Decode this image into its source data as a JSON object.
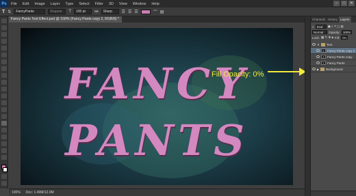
{
  "app": {
    "logo": "Ps"
  },
  "menu": [
    "File",
    "Edit",
    "Image",
    "Layer",
    "Type",
    "Select",
    "Filter",
    "3D",
    "View",
    "Window",
    "Help"
  ],
  "window_controls": [
    "–",
    "□",
    "✕"
  ],
  "options": {
    "font_family": "FancyPants",
    "font_style": "Regular",
    "font_size": "100 pt",
    "anti_alias": "Sharp",
    "text_color": "#c97db0"
  },
  "document": {
    "tab_title": "Fancy Pants Text Effect.psd @ 100% (Fancy Pants copy 2, RGB/8) *",
    "line1": "FANCY",
    "line2": "PANTS",
    "callout": "Fill Opacity: 0%",
    "callout_color": "#f4ea3c"
  },
  "status": {
    "zoom": "100%",
    "doc_size": "Doc: 1.49M/12.0M"
  },
  "panel": {
    "tabs": [
      "Channels",
      "History",
      "Layers"
    ],
    "active_tab": "Layers",
    "kind": "Kind",
    "blend_mode": "Normal",
    "opacity_label": "Opacity:",
    "opacity_value": "100%",
    "lock_label": "Lock:",
    "fill_label": "Fill:",
    "fill_value": "0%",
    "layers": [
      {
        "name": "Text",
        "type": "group",
        "selected": false
      },
      {
        "name": "Fancy Pants copy 2",
        "type": "text",
        "selected": true
      },
      {
        "name": "Fancy Pants copy",
        "type": "text",
        "selected": false
      },
      {
        "name": "Fancy Pants",
        "type": "text",
        "selected": false
      },
      {
        "name": "Background",
        "type": "group",
        "selected": false
      }
    ]
  }
}
